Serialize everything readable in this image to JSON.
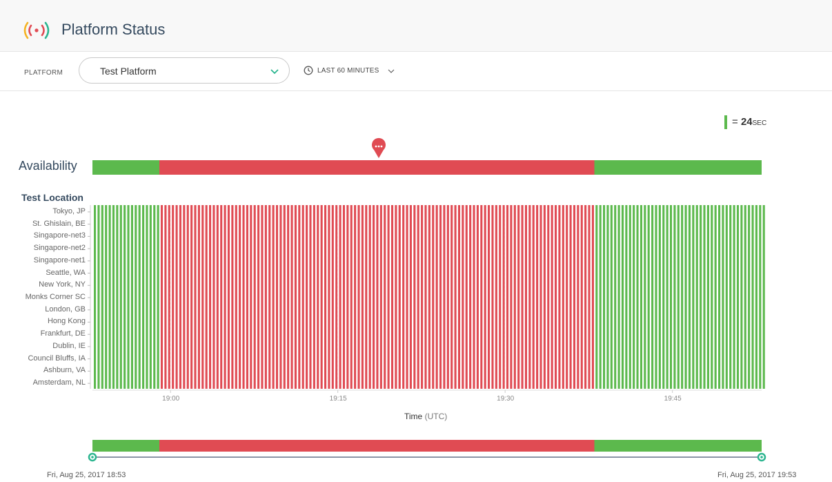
{
  "header": {
    "title": "Platform Status",
    "logo_icon": "signal-broadcast-icon"
  },
  "toolbar": {
    "platform_label": "PLATFORM",
    "platform_value": "Test Platform",
    "time_range_label": "LAST 60 MINUTES"
  },
  "legend": {
    "prefix": "= ",
    "value": "24",
    "unit": "SEC"
  },
  "colors": {
    "up": "#5cb94d",
    "down": "#e04b53",
    "accent": "#2bb58f"
  },
  "availability": {
    "label": "Availability",
    "segments": [
      {
        "status": "up",
        "from": "18:53",
        "to": "18:59"
      },
      {
        "status": "down",
        "from": "18:59",
        "to": "19:38"
      },
      {
        "status": "up",
        "from": "19:38",
        "to": "19:53"
      }
    ],
    "marker_icon": "incident-pin-icon"
  },
  "locations": {
    "title": "Test Location",
    "items": [
      "Tokyo, JP",
      "St. Ghislain, BE",
      "Singapore-net3",
      "Singapore-net2",
      "Singapore-net1",
      "Seattle, WA",
      "New York, NY",
      "Monks Corner SC",
      "London, GB",
      "Hong Kong",
      "Frankfurt, DE",
      "Dublin, IE",
      "Council Bluffs, IA",
      "Ashburn, VA",
      "Amsterdam, NL"
    ]
  },
  "chart_data": {
    "type": "heatmap",
    "title": "",
    "xlabel": "Time",
    "xlabel_unit": "(UTC)",
    "ylabel": "Test Location",
    "x_ticks": [
      "19:00",
      "19:15",
      "19:30",
      "19:45"
    ],
    "interval_seconds": 24,
    "series": [
      {
        "name": "up",
        "from": "18:53",
        "to": "18:59",
        "status": "up"
      },
      {
        "name": "down",
        "from": "18:59",
        "to": "19:38",
        "status": "down"
      },
      {
        "name": "up",
        "from": "19:38",
        "to": "19:53",
        "status": "up"
      }
    ]
  },
  "range": {
    "start": "Fri, Aug 25, 2017 18:53",
    "end": "Fri, Aug 25, 2017 19:53"
  }
}
